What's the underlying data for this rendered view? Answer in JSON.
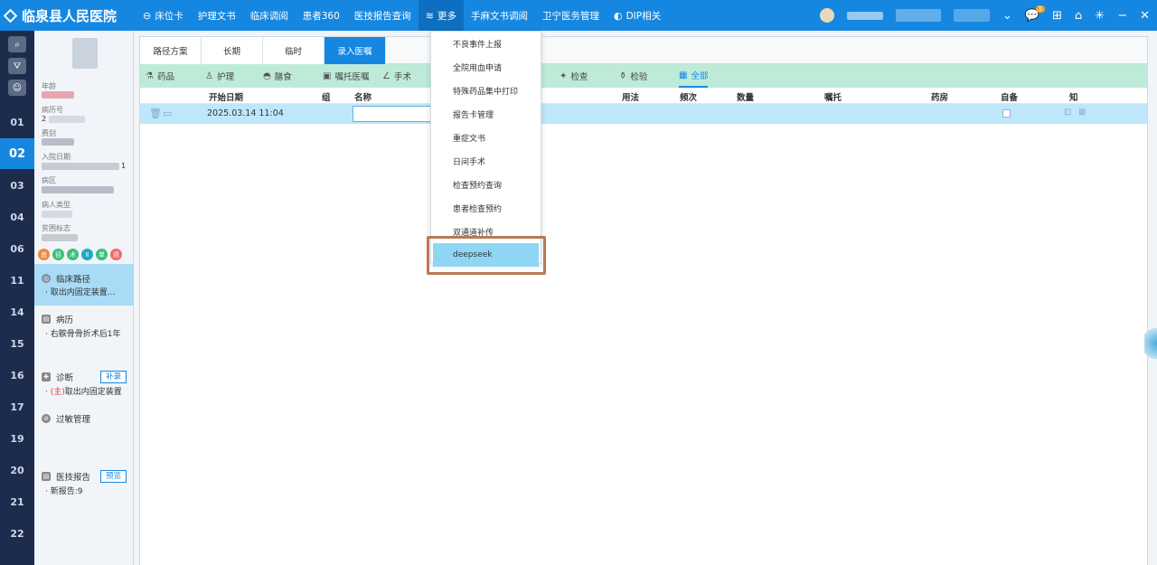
{
  "app": {
    "title": "临泉县人民医院"
  },
  "topnav": [
    {
      "icon": "back-circle-icon",
      "label": "床位卡"
    },
    {
      "label": "护理文书"
    },
    {
      "label": "临床调阅"
    },
    {
      "label": "患者360"
    },
    {
      "label": "医技报告查询"
    },
    {
      "icon": "layers-icon",
      "label": "更多"
    },
    {
      "label": "手麻文书调阅"
    },
    {
      "label": "卫宁医务管理"
    },
    {
      "icon": "dip-icon",
      "label": "DIP相关"
    }
  ],
  "notifications": {
    "count": "1"
  },
  "rail": {
    "numbers": [
      "01",
      "02",
      "03",
      "04",
      "06",
      "11",
      "14",
      "15",
      "16",
      "17",
      "19",
      "20",
      "21",
      "22"
    ],
    "active": "02"
  },
  "patient": {
    "age_label": "年龄",
    "record_label": "病历号",
    "record_value": "2",
    "category_label": "费别",
    "admit_label": "入院日期",
    "admit_value_tail": "1",
    "ward_label": "病区",
    "type_label": "病人类型",
    "poverty_label": "贫困标志",
    "tags": [
      "良",
      "径",
      "术",
      "Ⅱ",
      "单",
      "退"
    ],
    "sections": {
      "path": {
        "title": "临床路径",
        "sub": "· 取出内固定装置..."
      },
      "record": {
        "title": "病历",
        "sub": "· 右髌骨骨折术后1年"
      },
      "diag": {
        "title": "诊断",
        "button": "补录",
        "sub_prefix": "(主)",
        "sub": "取出内固定装置"
      },
      "allergy": {
        "title": "过敏管理"
      },
      "report": {
        "title": "医技报告",
        "button": "预览",
        "sub": "· 新报告:9"
      }
    }
  },
  "tabs": [
    "路径方案",
    "长期",
    "临时",
    "录入医嘱"
  ],
  "categories": [
    {
      "label": "药品"
    },
    {
      "label": "护理"
    },
    {
      "label": "膳食"
    },
    {
      "label": "嘱托医嘱"
    },
    {
      "label": "手术"
    },
    {
      "label": "检查"
    },
    {
      "label": "检验"
    },
    {
      "label": "全部"
    }
  ],
  "grid": {
    "headers": [
      "开始日期",
      "组",
      "名称",
      "用法",
      "频次",
      "数量",
      "嘱托",
      "药房",
      "自备",
      "知"
    ],
    "row": {
      "date": "2025.03.14 11:04"
    }
  },
  "dropdown": {
    "items": [
      "不良事件上报",
      "全院用血申请",
      "特殊药品集中打印",
      "报告卡管理",
      "重症文书",
      "日间手术",
      "检查预约查询",
      "患者检查预约",
      "双通道补传",
      "deepseek"
    ],
    "highlighted": "deepseek"
  },
  "colors": {
    "primary": "#1687e0",
    "rail": "#1d2c4c",
    "category_bar": "#bdebd8",
    "row_selected": "#bfe7fb",
    "highlight_box": "#b77a55"
  }
}
